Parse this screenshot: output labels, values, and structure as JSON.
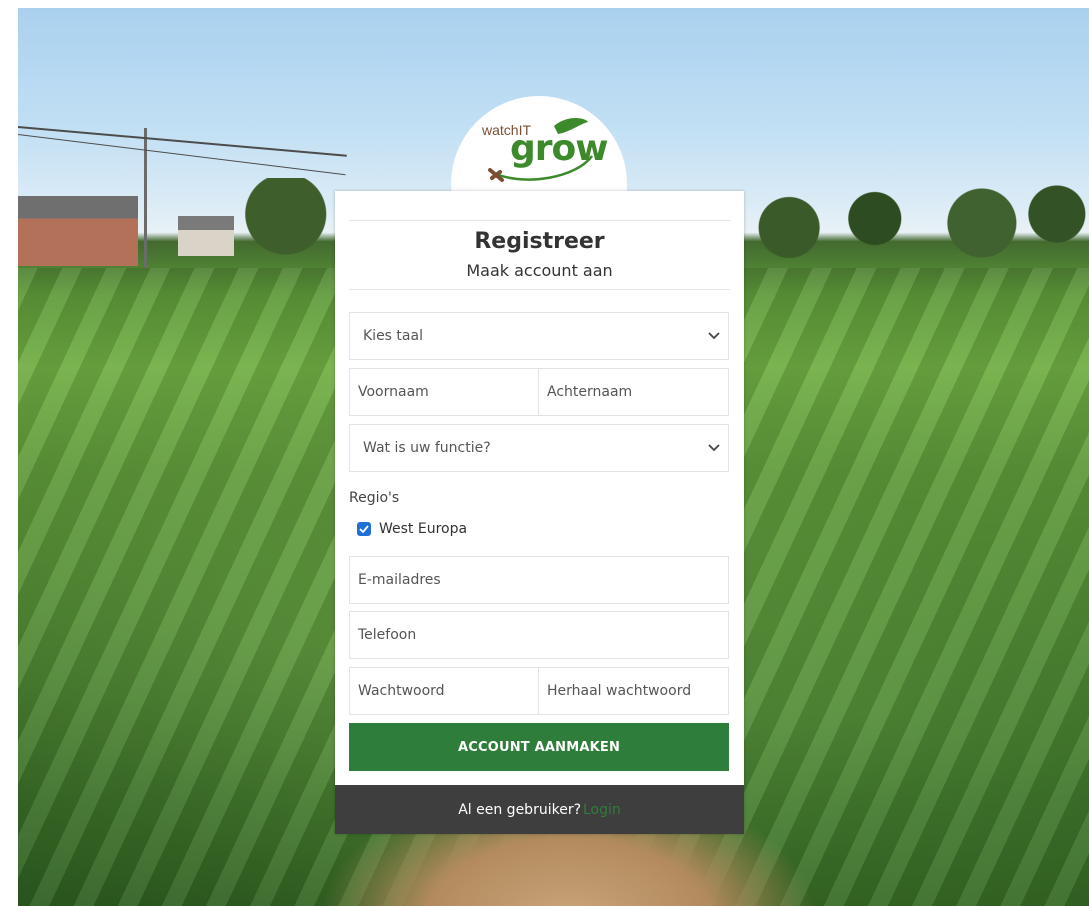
{
  "logo": {
    "line1": "watchIT",
    "line2": "grow",
    "brand_green": "#3d8a2c",
    "brand_brown": "#7a4f35"
  },
  "form": {
    "title": "Registreer",
    "subtitle": "Maak account aan",
    "language_select": {
      "value": "Kies taal"
    },
    "first_name": {
      "placeholder": "Voornaam"
    },
    "last_name": {
      "placeholder": "Achternaam"
    },
    "function_select": {
      "value": "Wat is uw functie?"
    },
    "regions_label": "Regio's",
    "regions": [
      {
        "label": "West Europa",
        "checked": true
      }
    ],
    "email": {
      "placeholder": "E-mailadres"
    },
    "phone": {
      "placeholder": "Telefoon"
    },
    "password": {
      "placeholder": "Wachtwoord"
    },
    "password_repeat": {
      "placeholder": "Herhaal wachtwoord"
    },
    "submit_label": "ACCOUNT AANMAKEN",
    "submit_color": "#2f7d3b"
  },
  "footer": {
    "prompt": "Al een gebruiker?",
    "login_link": "Login",
    "background": "#3e3e3e"
  },
  "icons": {
    "select_chevron": "chevron-down-icon",
    "checkbox": "checkmark-icon"
  }
}
